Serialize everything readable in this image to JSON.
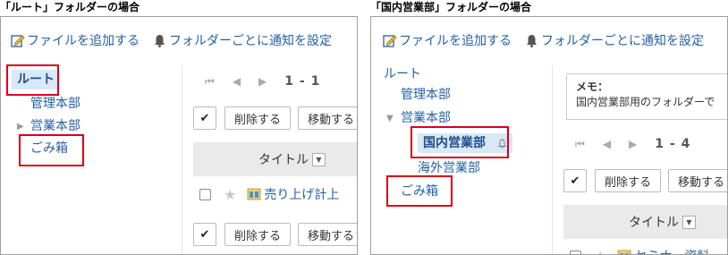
{
  "left": {
    "caption": "「ルート」フォルダーの場合",
    "toolbar": {
      "add_file": "ファイルを追加する",
      "notify": "フォルダーごとに通知を設定"
    },
    "tree": {
      "root": "ルート",
      "kanri": "管理本部",
      "eigyo": "営業本部",
      "trash": "ごみ箱"
    },
    "pager": {
      "first": "⏮",
      "prev": "◀",
      "next": "▶",
      "count": "1 - 1"
    },
    "buttons": {
      "check": "✔",
      "delete": "削除する",
      "move": "移動する"
    },
    "header": {
      "title": "タイトル",
      "sort": "▼"
    },
    "rows": [
      {
        "title": "売り上げ計上"
      }
    ]
  },
  "right": {
    "caption": "「国内営業部」フォルダーの場合",
    "toolbar": {
      "add_file": "ファイルを追加する",
      "notify": "フォルダーごとに通知を設定"
    },
    "tree": {
      "root": "ルート",
      "kanri": "管理本部",
      "eigyo": "営業本部",
      "kokunai": "国内営業部",
      "kaigai": "海外営業部",
      "trash": "ごみ箱"
    },
    "memo": {
      "label": "メモ：",
      "text": "国内営業部用のフォルダーで"
    },
    "pager": {
      "first": "⏮",
      "prev": "◀",
      "next": "▶",
      "count": "1 - 4"
    },
    "buttons": {
      "check": "✔",
      "delete": "削除する",
      "move": "移動する"
    },
    "header": {
      "title": "タイトル",
      "sort": "▼"
    },
    "rows": [
      {
        "title": "セミナー資料"
      }
    ]
  },
  "colors": {
    "link": "#2360a5",
    "highlight": "#d9001b",
    "selected_bg": "#d9e8f6"
  }
}
